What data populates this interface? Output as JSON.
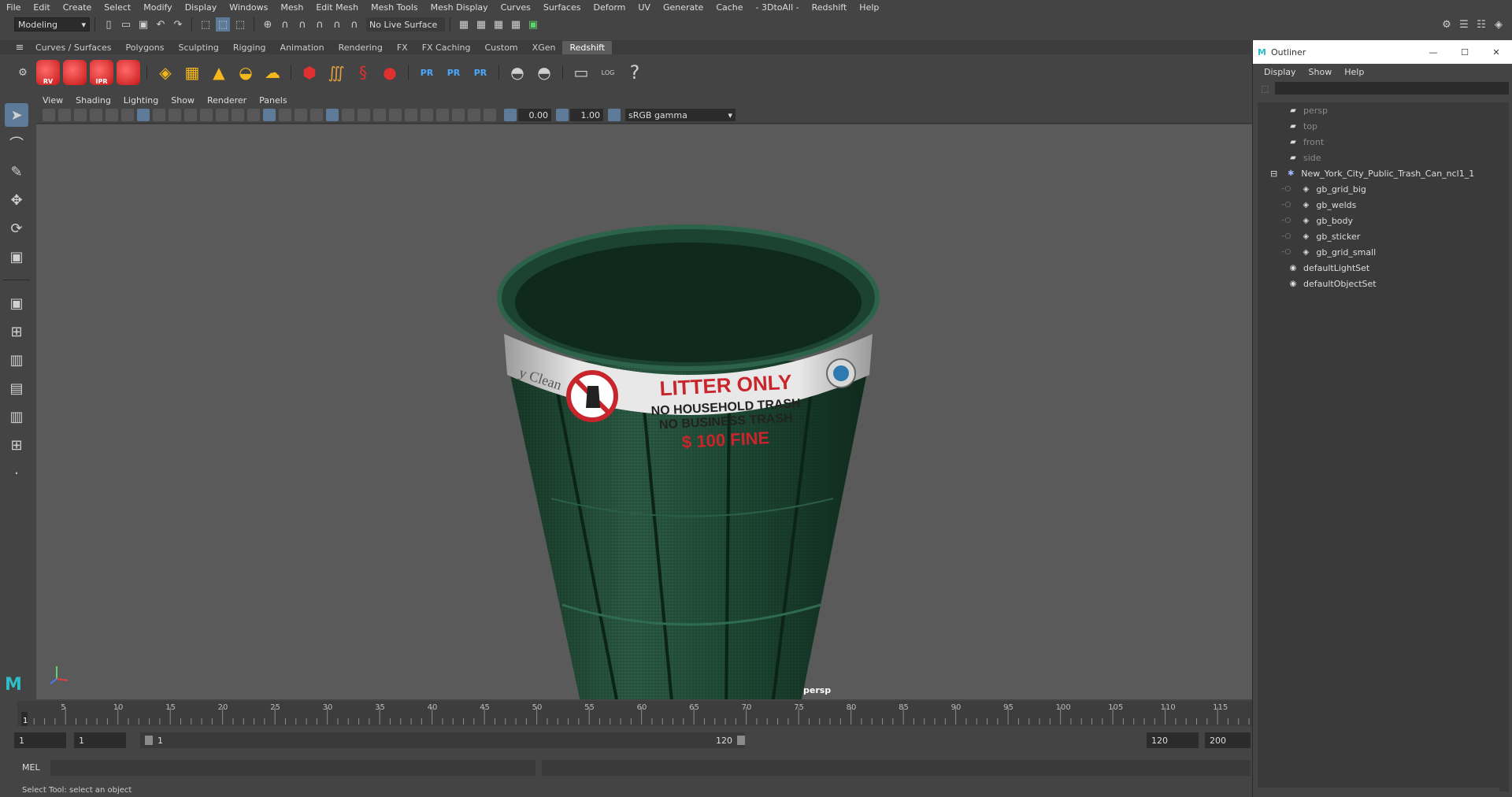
{
  "menus": [
    "File",
    "Edit",
    "Create",
    "Select",
    "Modify",
    "Display",
    "Windows",
    "Mesh",
    "Edit Mesh",
    "Mesh Tools",
    "Mesh Display",
    "Curves",
    "Surfaces",
    "Deform",
    "UV",
    "Generate",
    "Cache",
    "- 3DtoAll -",
    "Redshift",
    "Help"
  ],
  "status": {
    "mode": "Modeling",
    "live_surface": "No Live Surface"
  },
  "shelf_tabs": [
    {
      "label": "Curves / Surfaces",
      "active": false
    },
    {
      "label": "Polygons",
      "active": false
    },
    {
      "label": "Sculpting",
      "active": false
    },
    {
      "label": "Rigging",
      "active": false
    },
    {
      "label": "Animation",
      "active": false
    },
    {
      "label": "Rendering",
      "active": false
    },
    {
      "label": "FX",
      "active": false
    },
    {
      "label": "FX Caching",
      "active": false
    },
    {
      "label": "Custom",
      "active": false
    },
    {
      "label": "XGen",
      "active": false
    },
    {
      "label": "Redshift",
      "active": true
    }
  ],
  "shelf_labels": {
    "rv": "RV",
    "ipr": "IPR",
    "pr": "PR",
    "log": "LOG",
    "help": "?"
  },
  "panel_menu": [
    "View",
    "Shading",
    "Lighting",
    "Show",
    "Renderer",
    "Panels"
  ],
  "panel_toolbar": {
    "exposure": "0.00",
    "gamma_value": "1.00",
    "colorspace": "sRGB gamma"
  },
  "viewport": {
    "camera_label": "persp",
    "sticker": {
      "headline": "LITTER ONLY",
      "line1": "NO HOUSEHOLD TRASH",
      "line2": "NO BUSINESS TRASH",
      "fine": "$ 100  FINE",
      "side_text": "y Clean"
    }
  },
  "timeline": {
    "ticks": [
      "5",
      "10",
      "15",
      "20",
      "25",
      "30",
      "35",
      "40",
      "45",
      "50",
      "55",
      "60",
      "65",
      "70",
      "75",
      "80",
      "85",
      "90",
      "95",
      "100",
      "105",
      "110",
      "115"
    ],
    "current": "1"
  },
  "range": {
    "start": "1",
    "playback_start": "1",
    "slider_start": "1",
    "slider_end": "120",
    "end": "120",
    "max": "200"
  },
  "command_line": {
    "label": "MEL"
  },
  "help_line": "Select Tool: select an object",
  "outliner": {
    "title": "Outliner",
    "menus": [
      "Display",
      "Show",
      "Help"
    ],
    "items": [
      {
        "label": "persp",
        "type": "camera",
        "indent": 1,
        "dim": true
      },
      {
        "label": "top",
        "type": "camera",
        "indent": 1,
        "dim": true
      },
      {
        "label": "front",
        "type": "camera",
        "indent": 1,
        "dim": true
      },
      {
        "label": "side",
        "type": "camera",
        "indent": 1,
        "dim": true
      },
      {
        "label": "New_York_City_Public_Trash_Can_ncl1_1",
        "type": "group",
        "indent": 0,
        "dim": false,
        "expanded": true
      },
      {
        "label": "gb_grid_big",
        "type": "mesh",
        "indent": 2,
        "dim": false
      },
      {
        "label": "gb_welds",
        "type": "mesh",
        "indent": 2,
        "dim": false
      },
      {
        "label": "gb_body",
        "type": "mesh",
        "indent": 2,
        "dim": false
      },
      {
        "label": "gb_sticker",
        "type": "mesh",
        "indent": 2,
        "dim": false
      },
      {
        "label": "gb_grid_small",
        "type": "mesh",
        "indent": 2,
        "dim": false
      },
      {
        "label": "defaultLightSet",
        "type": "set",
        "indent": 1,
        "dim": false
      },
      {
        "label": "defaultObjectSet",
        "type": "set",
        "indent": 1,
        "dim": false
      }
    ]
  },
  "colors": {
    "can_green": "#1f4a36",
    "sticker_red": "#c8262c",
    "accent_blue": "#5d7a99"
  }
}
